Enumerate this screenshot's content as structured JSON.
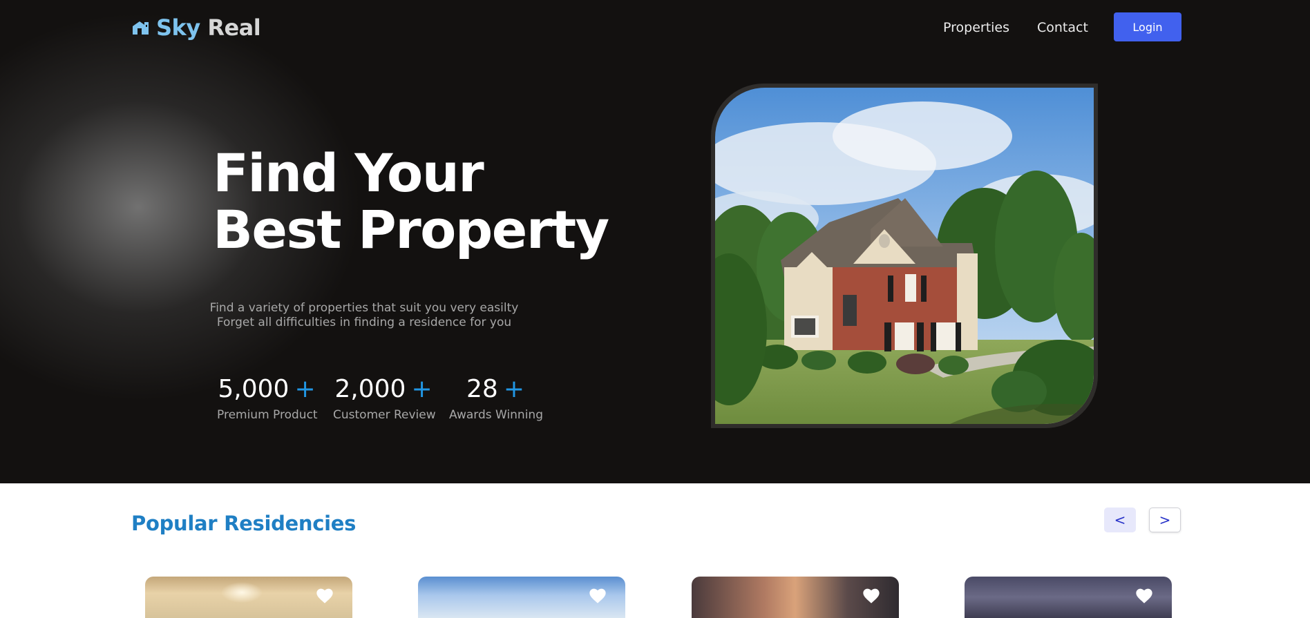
{
  "header": {
    "logo": {
      "part1": "Sky",
      "part2": "Real"
    },
    "nav": [
      {
        "label": "Properties"
      },
      {
        "label": "Contact"
      }
    ],
    "login_label": "Login"
  },
  "hero": {
    "title_line1": "Find Your",
    "title_line2": "Best Property",
    "subtitle_line1": "Find a variety of properties that suit you very easilty",
    "subtitle_line2": "Forget all difficulties in finding a residence for you",
    "stats": [
      {
        "value": "5,000",
        "suffix": "+",
        "label": "Premium Product"
      },
      {
        "value": "2,000",
        "suffix": "+",
        "label": "Customer Review"
      },
      {
        "value": "28",
        "suffix": "+",
        "label": "Awards Winning"
      }
    ]
  },
  "popular": {
    "title": "Popular Residencies",
    "prev_label": "<",
    "next_label": ">"
  },
  "colors": {
    "hero_bg": "#131110",
    "accent_blue": "#1f7fc4",
    "plus_blue": "#2196e3",
    "login_bg": "#4161ee",
    "logo_sky": "#7ec3ee"
  },
  "icons": [
    "home-logo-icon",
    "heart-icon",
    "chevron-left",
    "chevron-right"
  ]
}
